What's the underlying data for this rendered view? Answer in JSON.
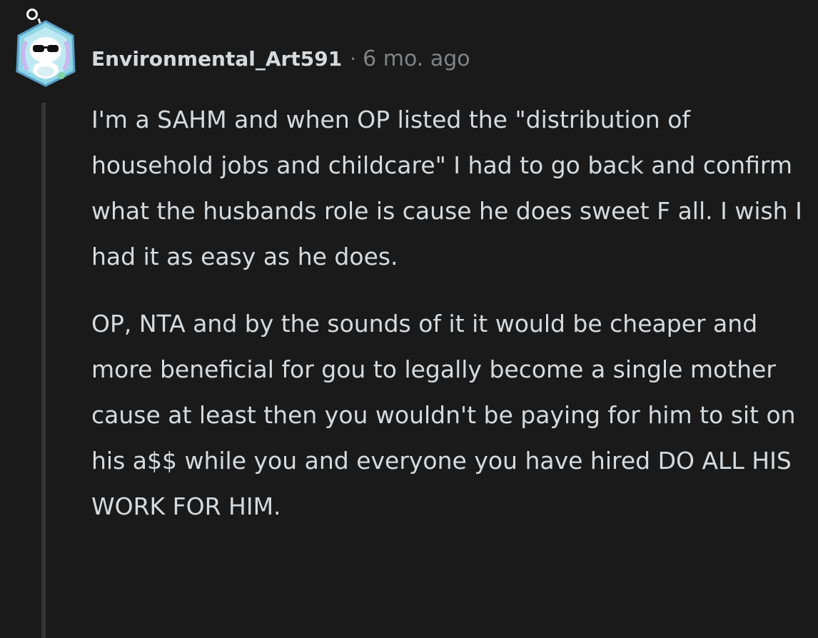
{
  "comment": {
    "author": "Environmental_Art591",
    "separator": "·",
    "timestamp": "6 mo. ago",
    "paragraphs": [
      "I'm a SAHM and when OP listed the \"distribution of household jobs and childcare\" I had to go back and confirm what the husbands role is cause he does sweet F all. I wish I had it as easy as he does.",
      "OP, NTA and by the sounds of it it would be cheaper and more beneficial for gou to legally become a single mother cause at least then you wouldn't be paying for him to sit on his a$$ while you and everyone you have hired DO ALL HIS WORK FOR HIM."
    ]
  },
  "colors": {
    "background": "#1a1a1b",
    "text": "#d7dadc",
    "meta": "#818384",
    "thread_line": "#343536"
  },
  "icons": {
    "avatar": "snoo-avatar-icon"
  }
}
